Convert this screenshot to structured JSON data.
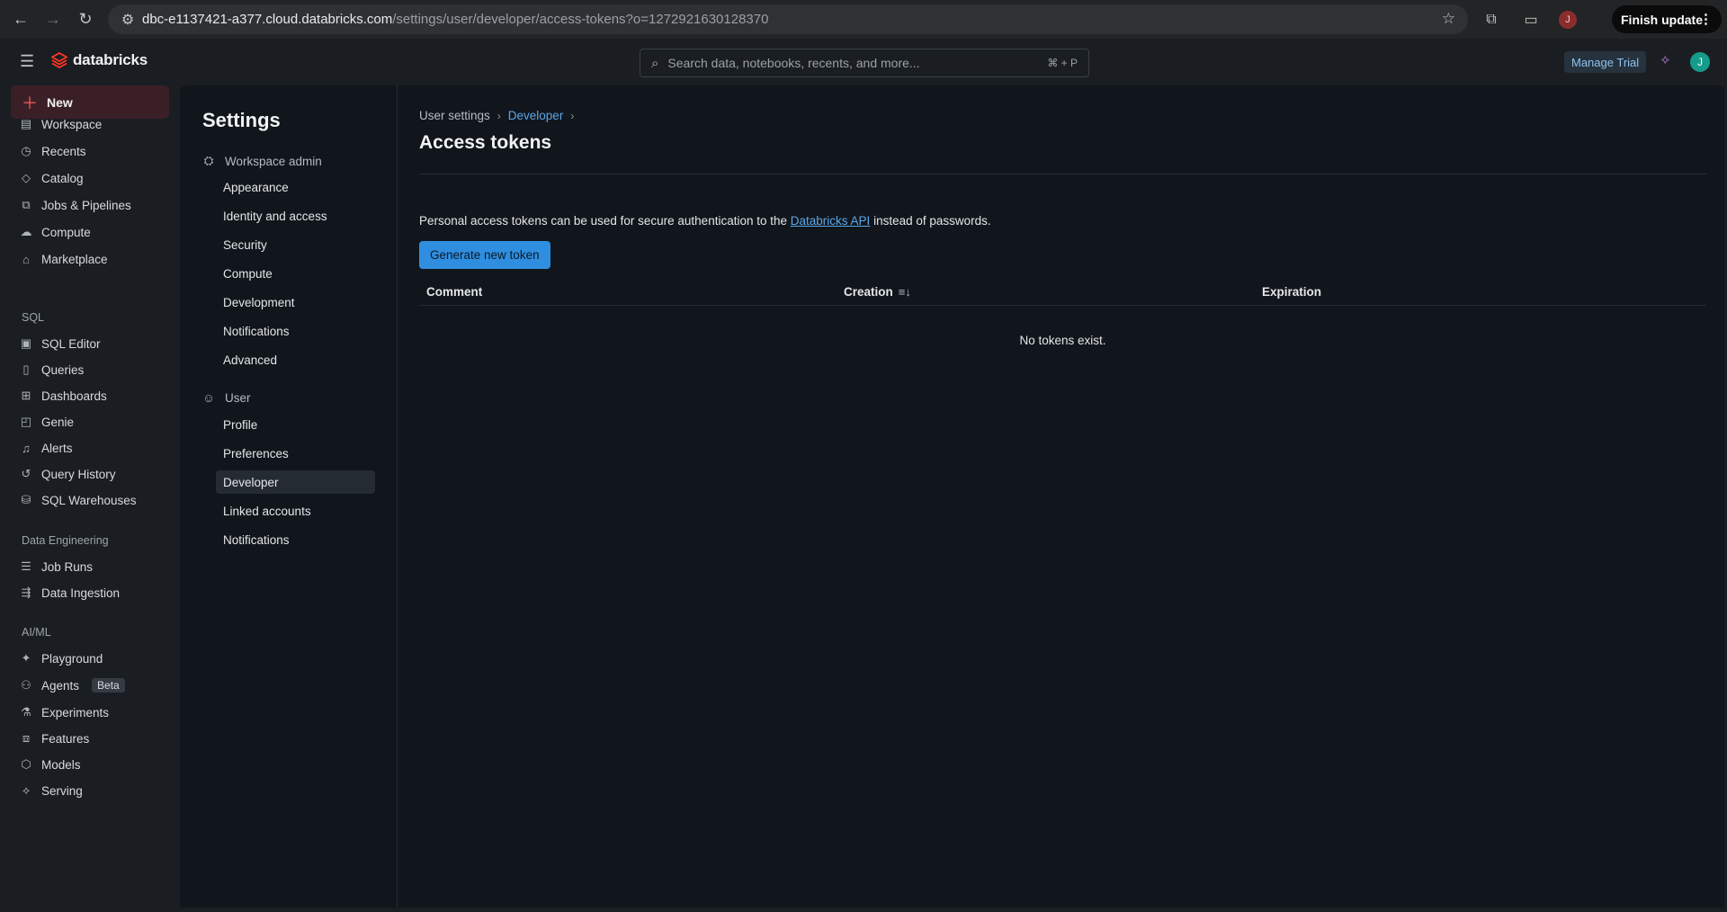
{
  "browser": {
    "url_host": "dbc-e1137421-a377.cloud.databricks.com",
    "url_path": "/settings/user/developer/access-tokens?o=1272921630128370",
    "profile_initial": "J",
    "finish_update_label": "Finish update"
  },
  "app": {
    "logo_text": "databricks",
    "search_placeholder": "Search data, notebooks, recents, and more...",
    "search_shortcut": "⌘ + P",
    "manage_trial_label": "Manage Trial",
    "user_initial": "J",
    "accent_color": "#2f8ee0"
  },
  "sidebar": {
    "new_label": "New",
    "items_top": [
      {
        "label": "Workspace",
        "icon": "workspace-icon"
      },
      {
        "label": "Recents",
        "icon": "clock-icon"
      },
      {
        "label": "Catalog",
        "icon": "catalog-icon"
      },
      {
        "label": "Jobs & Pipelines",
        "icon": "workflows-icon"
      },
      {
        "label": "Compute",
        "icon": "cloud-icon"
      },
      {
        "label": "Marketplace",
        "icon": "marketplace-icon"
      }
    ],
    "sql_section": "SQL",
    "items_sql": [
      {
        "label": "SQL Editor",
        "icon": "sql-editor-icon"
      },
      {
        "label": "Queries",
        "icon": "query-icon"
      },
      {
        "label": "Dashboards",
        "icon": "dashboard-icon"
      },
      {
        "label": "Genie",
        "icon": "genie-icon"
      },
      {
        "label": "Alerts",
        "icon": "bell-icon"
      },
      {
        "label": "Query History",
        "icon": "history-icon"
      },
      {
        "label": "SQL Warehouses",
        "icon": "warehouse-icon"
      }
    ],
    "de_section": "Data Engineering",
    "items_de": [
      {
        "label": "Job Runs",
        "icon": "list-icon"
      },
      {
        "label": "Data Ingestion",
        "icon": "ingestion-icon"
      }
    ],
    "ai_section": "AI/ML",
    "items_ai": [
      {
        "label": "Playground",
        "icon": "playground-icon"
      },
      {
        "label": "Agents",
        "icon": "agents-icon",
        "badge": "Beta"
      },
      {
        "label": "Experiments",
        "icon": "experiments-icon"
      },
      {
        "label": "Features",
        "icon": "features-icon"
      },
      {
        "label": "Models",
        "icon": "models-icon"
      },
      {
        "label": "Serving",
        "icon": "serving-icon"
      }
    ]
  },
  "settings": {
    "title": "Settings",
    "workspace_admin_label": "Workspace admin",
    "workspace_admin_items": [
      "Appearance",
      "Identity and access",
      "Security",
      "Compute",
      "Development",
      "Notifications",
      "Advanced"
    ],
    "user_label": "User",
    "user_items": [
      "Profile",
      "Preferences",
      "Developer",
      "Linked accounts",
      "Notifications"
    ],
    "active_item": "Developer"
  },
  "content": {
    "breadcrumb": [
      "User settings",
      "Developer"
    ],
    "title": "Access tokens",
    "description_before": "Personal access tokens can be used for secure authentication to the ",
    "description_link": "Databricks API",
    "description_after": " instead of passwords.",
    "generate_button": "Generate new token",
    "columns": [
      "Comment",
      "Creation",
      "Expiration"
    ],
    "empty_text": "No tokens exist."
  }
}
